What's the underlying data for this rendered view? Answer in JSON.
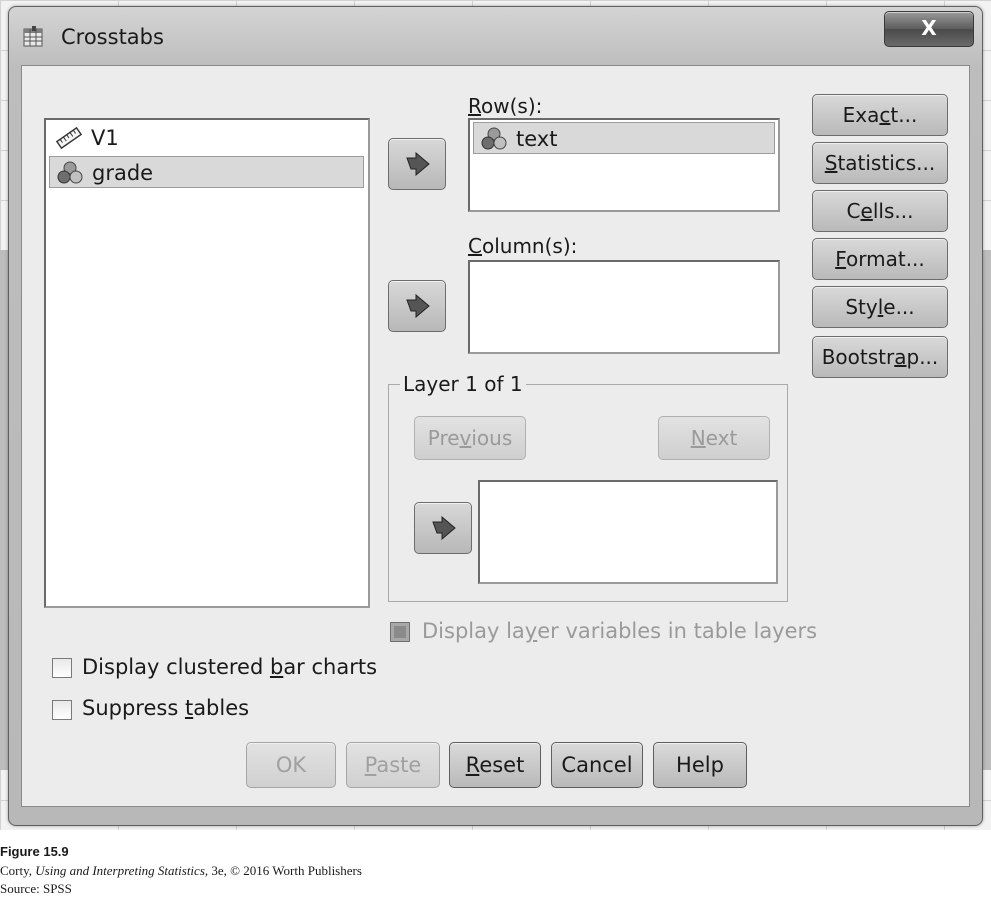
{
  "window": {
    "title": "Crosstabs",
    "close_label": "X"
  },
  "variables": [
    {
      "name": "V1",
      "icon": "ruler-scale-icon"
    },
    {
      "name": "grade",
      "icon": "nominal-circles-icon",
      "selected": true
    }
  ],
  "rows": {
    "label_pre": "",
    "label_ul": "R",
    "label_post": "ow(s):",
    "items": [
      {
        "name": "text",
        "icon": "nominal-circles-icon"
      }
    ]
  },
  "columns": {
    "label_pre": "",
    "label_ul": "C",
    "label_post": "olumn(s):"
  },
  "layer": {
    "legend": "Layer 1 of 1",
    "previous": {
      "pre": "Pre",
      "ul": "v",
      "post": "ious"
    },
    "next": {
      "pre": "",
      "ul": "N",
      "post": "ext"
    }
  },
  "side_buttons": [
    {
      "pre": "Exa",
      "ul": "c",
      "post": "t..."
    },
    {
      "pre": "",
      "ul": "S",
      "post": "tatistics..."
    },
    {
      "pre": "C",
      "ul": "e",
      "post": "lls..."
    },
    {
      "pre": "",
      "ul": "F",
      "post": "ormat..."
    },
    {
      "pre": "Sty",
      "ul": "l",
      "post": "e..."
    },
    {
      "pre": "Bootstr",
      "ul": "a",
      "post": "p..."
    }
  ],
  "options": {
    "display_layer": {
      "pre": "Display la",
      "ul": "y",
      "post": "er variables in table layers",
      "enabled": false
    },
    "clustered": {
      "pre": "Display clustered ",
      "ul": "b",
      "post": "ar charts",
      "checked": false
    },
    "suppress": {
      "pre": "Suppress ",
      "ul": "t",
      "post": "ables",
      "checked": false
    }
  },
  "buttons": {
    "ok": {
      "pre": "OK",
      "ul": "",
      "post": ""
    },
    "paste": {
      "pre": "",
      "ul": "P",
      "post": "aste"
    },
    "reset": {
      "pre": "",
      "ul": "R",
      "post": "eset"
    },
    "cancel": {
      "pre": "Cancel",
      "ul": "",
      "post": ""
    },
    "help": {
      "pre": "Help",
      "ul": "",
      "post": ""
    }
  },
  "caption": {
    "figure": "Figure 15.9",
    "credit_pre": "Corty, ",
    "credit_italic": "Using and Interpreting Statistics,",
    "credit_post": " 3e, © 2016 Worth Publishers",
    "source": "Source: SPSS"
  },
  "colors": {
    "window_bg": "#ececec",
    "title_bar": "#c8c8c8",
    "close_button": "#5c5c5c",
    "disabled_text": "#9a9a9a"
  }
}
